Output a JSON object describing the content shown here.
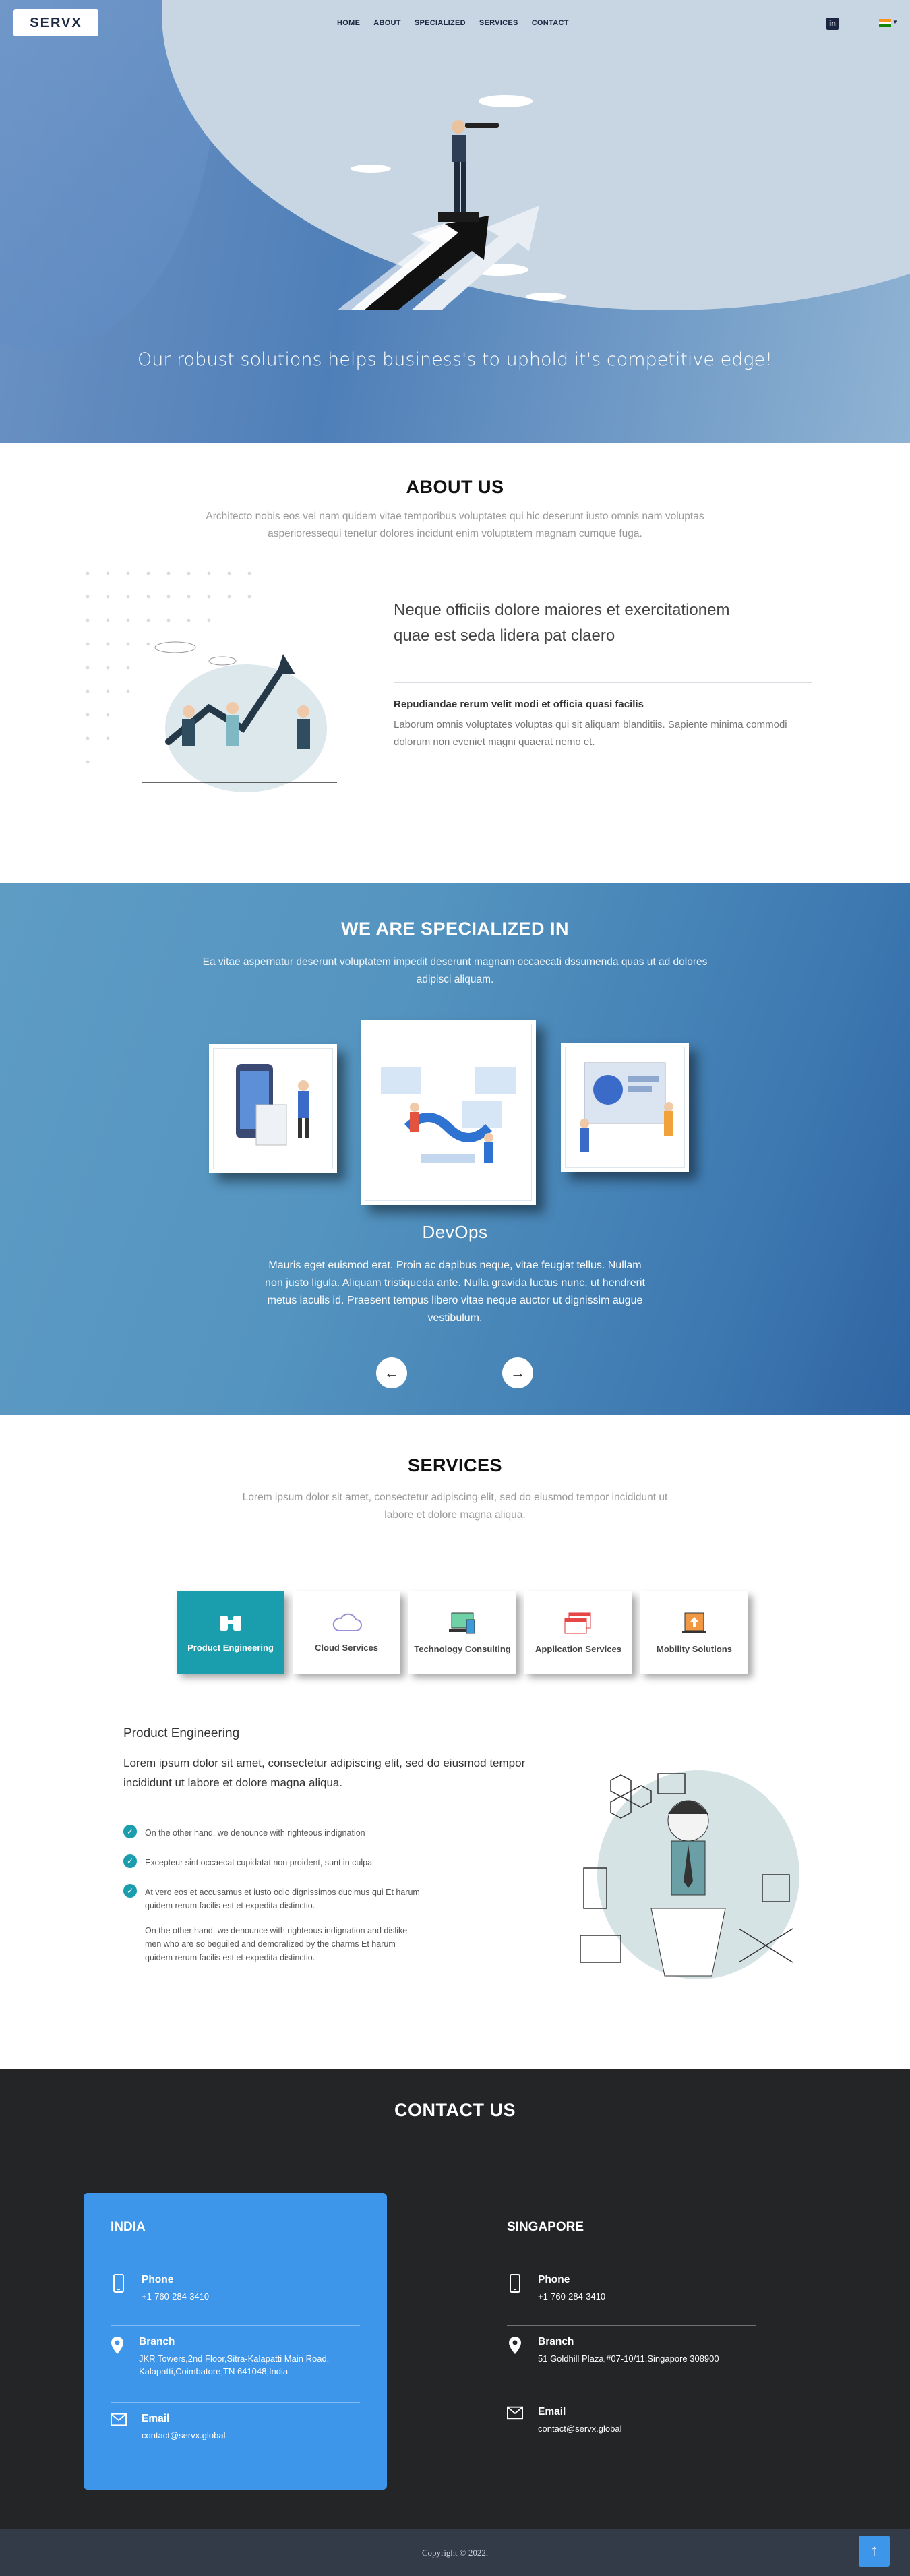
{
  "header": {
    "logo_text": "SERVX",
    "nav": [
      "HOME",
      "ABOUT",
      "SPECIALIZED",
      "SERVICES",
      "CONTACT"
    ],
    "linkedin_label": "in"
  },
  "hero": {
    "tagline": "Our robust solutions helps business's to uphold it's competitive edge!"
  },
  "about": {
    "title": "ABOUT US",
    "subtitle": "Architecto nobis eos vel nam quidem vitae temporibus voluptates qui hic deserunt iusto omnis nam voluptas asperioressequi tenetur dolores incidunt enim voluptatem magnam cumque fuga.",
    "heading": "Neque officiis dolore maiores et exercitationem quae est seda lidera pat claero",
    "strong": "Repudiandae rerum velit modi et officia quasi facilis",
    "body": "Laborum omnis voluptates voluptas qui sit aliquam blanditiis. Sapiente minima commodi dolorum non eveniet magni quaerat nemo et."
  },
  "specialized": {
    "title": "WE ARE SPECIALIZED IN",
    "subtitle": "Ea vitae aspernatur deserunt voluptatem impedit deserunt magnam occaecati dssumenda quas ut ad dolores adipisci aliquam.",
    "active_item": "DevOps",
    "description": "Mauris eget euismod erat. Proin ac dapibus neque, vitae feugiat tellus. Nullam non justo ligula. Aliquam tristiqueda ante. Nulla gravida luctus nunc, ut hendrerit metus iaculis id. Praesent tempus libero vitae neque auctor ut dignissim augue vestibulum.",
    "prev_icon": "←",
    "next_icon": "→"
  },
  "services": {
    "title": "SERVICES",
    "subtitle": "Lorem ipsum dolor sit amet, consectetur adipiscing elit, sed do eiusmod tempor incididunt ut labore et dolore magna aliqua.",
    "tabs": [
      {
        "label": "Product Engineering",
        "icon": "binoculars-icon"
      },
      {
        "label": "Cloud Services",
        "icon": "cloud-icon"
      },
      {
        "label": "Technology Consulting",
        "icon": "devices-icon"
      },
      {
        "label": "Application Services",
        "icon": "browser-windows-icon"
      },
      {
        "label": "Mobility Solutions",
        "icon": "mobile-upload-icon"
      }
    ],
    "active_tab": "Product Engineering",
    "detail_title": "Product Engineering",
    "detail_intro": "Lorem ipsum dolor sit amet, consectetur adipiscing elit, sed do eiusmod tempor incididunt ut labore et dolore magna aliqua.",
    "checks": [
      "On the other hand, we denounce with righteous indignation",
      "Excepteur sint occaecat cupidatat non proident, sunt in culpa",
      "At vero eos et accusamus et iusto odio dignissimos ducimus qui Et harum quidem rerum facilis est et expedita distinctio."
    ],
    "extra": "On the other hand, we denounce with righteous indignation and dislike men who are so beguiled and demoralized by the charms Et harum quidem rerum facilis est et expedita distinctio."
  },
  "contact": {
    "title": "CONTACT US",
    "offices": [
      {
        "name": "INDIA",
        "phone_label": "Phone",
        "phone": "+1-760-284-3410",
        "branch_label": "Branch",
        "branch": "JKR Towers,2nd Floor,Sitra-Kalapatti Main Road, Kalapatti,Coimbatore,TN 641048,India",
        "email_label": "Email",
        "email": "contact@servx.global"
      },
      {
        "name": "SINGAPORE",
        "phone_label": "Phone",
        "phone": "+1-760-284-3410",
        "branch_label": "Branch",
        "branch": "51 Goldhill Plaza,#07-10/11,Singapore 308900",
        "email_label": "Email",
        "email": "contact@servx.global"
      }
    ]
  },
  "footer": {
    "copyright": "Copyright © 2022.",
    "to_top_icon": "↑"
  },
  "colors": {
    "accent": "#1a9dad",
    "contact_card": "#3e96ea",
    "footer": "#343b48",
    "contact_bg": "#242527"
  }
}
